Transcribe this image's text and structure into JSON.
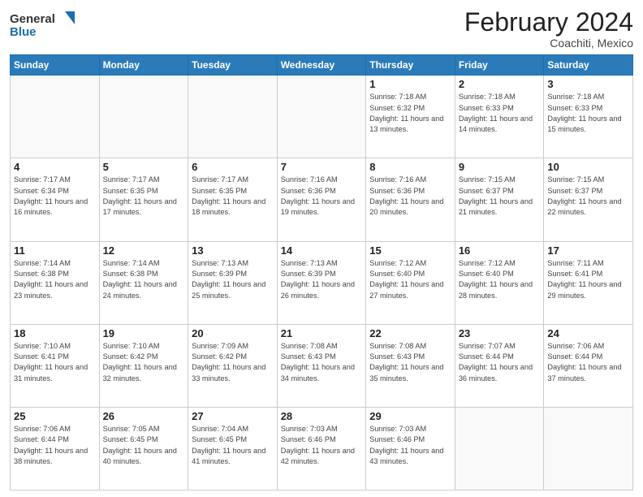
{
  "header": {
    "logo_general": "General",
    "logo_blue": "Blue",
    "month": "February 2024",
    "location": "Coachiti, Mexico"
  },
  "weekdays": [
    "Sunday",
    "Monday",
    "Tuesday",
    "Wednesday",
    "Thursday",
    "Friday",
    "Saturday"
  ],
  "weeks": [
    [
      {
        "day": "",
        "info": ""
      },
      {
        "day": "",
        "info": ""
      },
      {
        "day": "",
        "info": ""
      },
      {
        "day": "",
        "info": ""
      },
      {
        "day": "1",
        "info": "Sunrise: 7:18 AM\nSunset: 6:32 PM\nDaylight: 11 hours and 13 minutes."
      },
      {
        "day": "2",
        "info": "Sunrise: 7:18 AM\nSunset: 6:33 PM\nDaylight: 11 hours and 14 minutes."
      },
      {
        "day": "3",
        "info": "Sunrise: 7:18 AM\nSunset: 6:33 PM\nDaylight: 11 hours and 15 minutes."
      }
    ],
    [
      {
        "day": "4",
        "info": "Sunrise: 7:17 AM\nSunset: 6:34 PM\nDaylight: 11 hours and 16 minutes."
      },
      {
        "day": "5",
        "info": "Sunrise: 7:17 AM\nSunset: 6:35 PM\nDaylight: 11 hours and 17 minutes."
      },
      {
        "day": "6",
        "info": "Sunrise: 7:17 AM\nSunset: 6:35 PM\nDaylight: 11 hours and 18 minutes."
      },
      {
        "day": "7",
        "info": "Sunrise: 7:16 AM\nSunset: 6:36 PM\nDaylight: 11 hours and 19 minutes."
      },
      {
        "day": "8",
        "info": "Sunrise: 7:16 AM\nSunset: 6:36 PM\nDaylight: 11 hours and 20 minutes."
      },
      {
        "day": "9",
        "info": "Sunrise: 7:15 AM\nSunset: 6:37 PM\nDaylight: 11 hours and 21 minutes."
      },
      {
        "day": "10",
        "info": "Sunrise: 7:15 AM\nSunset: 6:37 PM\nDaylight: 11 hours and 22 minutes."
      }
    ],
    [
      {
        "day": "11",
        "info": "Sunrise: 7:14 AM\nSunset: 6:38 PM\nDaylight: 11 hours and 23 minutes."
      },
      {
        "day": "12",
        "info": "Sunrise: 7:14 AM\nSunset: 6:38 PM\nDaylight: 11 hours and 24 minutes."
      },
      {
        "day": "13",
        "info": "Sunrise: 7:13 AM\nSunset: 6:39 PM\nDaylight: 11 hours and 25 minutes."
      },
      {
        "day": "14",
        "info": "Sunrise: 7:13 AM\nSunset: 6:39 PM\nDaylight: 11 hours and 26 minutes."
      },
      {
        "day": "15",
        "info": "Sunrise: 7:12 AM\nSunset: 6:40 PM\nDaylight: 11 hours and 27 minutes."
      },
      {
        "day": "16",
        "info": "Sunrise: 7:12 AM\nSunset: 6:40 PM\nDaylight: 11 hours and 28 minutes."
      },
      {
        "day": "17",
        "info": "Sunrise: 7:11 AM\nSunset: 6:41 PM\nDaylight: 11 hours and 29 minutes."
      }
    ],
    [
      {
        "day": "18",
        "info": "Sunrise: 7:10 AM\nSunset: 6:41 PM\nDaylight: 11 hours and 31 minutes."
      },
      {
        "day": "19",
        "info": "Sunrise: 7:10 AM\nSunset: 6:42 PM\nDaylight: 11 hours and 32 minutes."
      },
      {
        "day": "20",
        "info": "Sunrise: 7:09 AM\nSunset: 6:42 PM\nDaylight: 11 hours and 33 minutes."
      },
      {
        "day": "21",
        "info": "Sunrise: 7:08 AM\nSunset: 6:43 PM\nDaylight: 11 hours and 34 minutes."
      },
      {
        "day": "22",
        "info": "Sunrise: 7:08 AM\nSunset: 6:43 PM\nDaylight: 11 hours and 35 minutes."
      },
      {
        "day": "23",
        "info": "Sunrise: 7:07 AM\nSunset: 6:44 PM\nDaylight: 11 hours and 36 minutes."
      },
      {
        "day": "24",
        "info": "Sunrise: 7:06 AM\nSunset: 6:44 PM\nDaylight: 11 hours and 37 minutes."
      }
    ],
    [
      {
        "day": "25",
        "info": "Sunrise: 7:06 AM\nSunset: 6:44 PM\nDaylight: 11 hours and 38 minutes."
      },
      {
        "day": "26",
        "info": "Sunrise: 7:05 AM\nSunset: 6:45 PM\nDaylight: 11 hours and 40 minutes."
      },
      {
        "day": "27",
        "info": "Sunrise: 7:04 AM\nSunset: 6:45 PM\nDaylight: 11 hours and 41 minutes."
      },
      {
        "day": "28",
        "info": "Sunrise: 7:03 AM\nSunset: 6:46 PM\nDaylight: 11 hours and 42 minutes."
      },
      {
        "day": "29",
        "info": "Sunrise: 7:03 AM\nSunset: 6:46 PM\nDaylight: 11 hours and 43 minutes."
      },
      {
        "day": "",
        "info": ""
      },
      {
        "day": "",
        "info": ""
      }
    ]
  ]
}
